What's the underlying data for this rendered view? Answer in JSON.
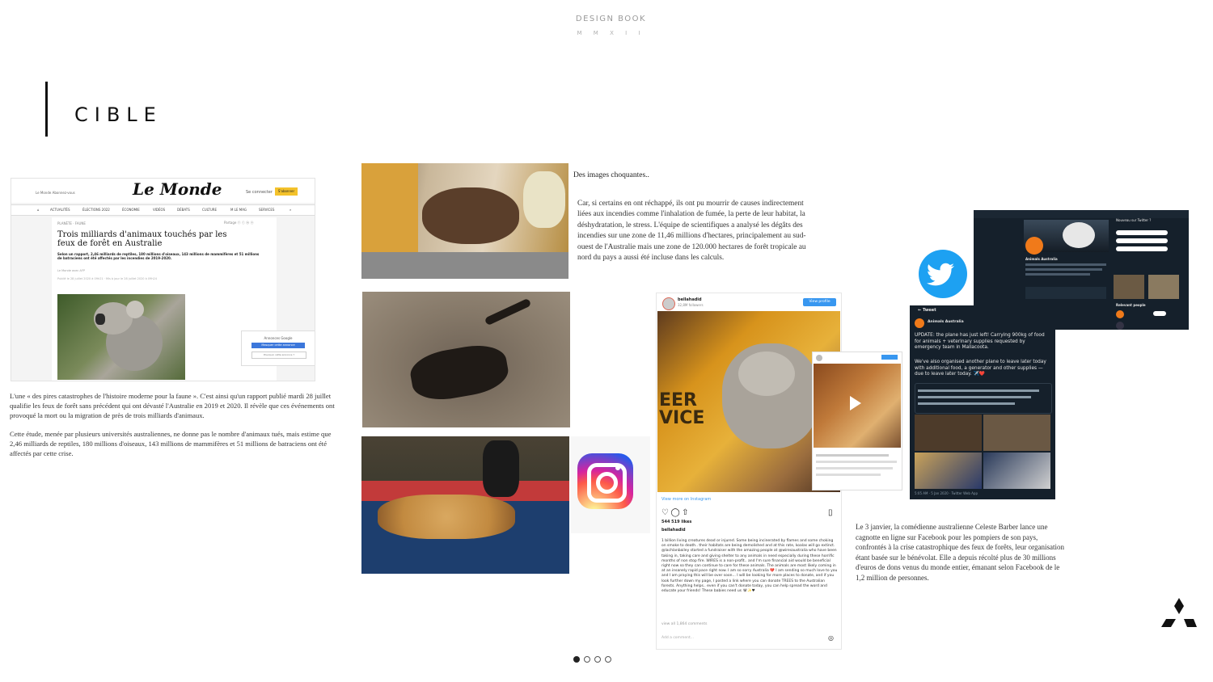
{
  "header": {
    "title": "DESIGN BOOK",
    "subtitle": "M M X I I"
  },
  "section": {
    "title": "CIBLE"
  },
  "lemonde": {
    "logo": "Le Monde",
    "left_text": "Le Monde Abonnez-vous",
    "search": "Se connecter",
    "subscribe": "S'abonner",
    "nav": [
      "ACTUALITÉS",
      "ÉLECTIONS 2022",
      "ÉCONOMIE",
      "VIDÉOS",
      "DÉBATS",
      "CULTURE",
      "M LE MAG",
      "SERVICES"
    ],
    "crumb": "PLANÈTE · FAUNE",
    "share": "Partage",
    "headline": "Trois milliards d'animaux touchés par les feux de forêt en Australie",
    "lede": "Selon un rapport, 2,46 milliards de reptiles, 180 millions d'oiseaux, 143 millions de mammifères et 51 millions de batraciens ont été affectés par les incendies de 2019-2020.",
    "meta": "Le Monde avec AFP",
    "meta2": "Publié le 28 juillet 2020 à 09h21 · Mis à jour le 28 juillet 2020 à 09h24",
    "ad_title": "Annonces Google",
    "ad_btn": "Masquer cette annonce",
    "ad_btn2": "Pourquoi cette annonce ?"
  },
  "paragraphs": {
    "p1": "L'une « des pires catastrophes de l'histoire moderne pour la faune ». C'est ainsi qu'un rapport publié mardi 28 juillet qualifie les feux de forêt sans précédent qui ont dévasté l'Australie en 2019 et 2020. Il révèle que ces événements ont provoqué la mort ou la migration de près de trois milliards d'animaux.",
    "p2": "Cette étude, menée par plusieurs universités australiennes, ne donne pas le nombre d'animaux tués, mais estime que 2,46 milliards de reptiles, 180 millions d'oiseaux, 143 millions de mammifères et 51 millions de batraciens ont été affectés par cette crise.",
    "p3_title": "Des images choquantes..",
    "p3": "Car, si certains en ont réchappé, ils ont pu mourrir de causes indirectement liées aux incendies comme l'inhalation de fumée, la perte de leur habitat, la déshydratation, le stress. L'équipe de scientifiques a analysé les dégâts des incendies sur une zone de 11,46 millions d'hectares, principalement au sud-ouest de l'Australie mais une zone de 120.000 hectares de forêt tropicale au nord du pays a aussi été incluse dans les calculs.",
    "p4": "Le 3 janvier, la comédienne australienne Celeste Barber lance une cagnotte en ligne sur Facebook pour les pompiers de son pays, confrontés à la crise catastrophique des feux de forêts, leur organisation étant basée sur le bénévolat. Elle a depuis récolté plus de 30 millions d'euros de dons venus du monde entier, émanant selon Facebook de le 1,2 million de personnes."
  },
  "instagram": {
    "user": "bellahadid",
    "followers": "32,8M followers",
    "button": "View profile",
    "view_more": "View more on Instagram",
    "likes": "544 519 likes",
    "caption_user": "bellahadid",
    "caption": "1 billion living creatures dead or injured. Some being incinerated by flames and some choking on smoke to death.. their habitats are being demolished and at this rate, koalas will go extinct. @lachlanbailey started a fundraiser with the amazing people at @wiresaustralia who have been taking in, taking care and giving shelter to any animals in need especially during these horrific months of non stop fire. WIRES is a non-profit.. and I'm sure financial aid would be beneficial right now so they can continue to care for these animals. The animals are most likely coming in at an insanely rapid pace right now. I am so sorry Australia 💔 I am sending so much love to you and I am praying this will be over soon... I will be looking for more places to donate, and if you look further down my page, I posted a link where you can donate TREES to the Australian forests. Anything helps.. even if you can't donate today, you can help spread the word and educate your friends! These babies need us 🐨✨♥",
    "view_comments": "view all 1,864 comments",
    "add_comment": "Add a comment...",
    "fire_text": "EER\nVICE"
  },
  "twitter": {
    "profile_name": "Animals Australia",
    "tweet_header": "Tweet",
    "tweet_user": "Animals Australia",
    "tweet_text1": "UPDATE: the plane has just left! Carrying 900kg of food for animals + veterinary supplies requested by emergency team in Mallacoota.",
    "tweet_text2": "We've also organised another plane to leave later today with additional food, a generator and other supplies — due to leave later today. ✈️❤️",
    "footer": "5:05 AM · 5 Jan 2020 · Twitter Web App",
    "side_title": "Relevant people"
  }
}
